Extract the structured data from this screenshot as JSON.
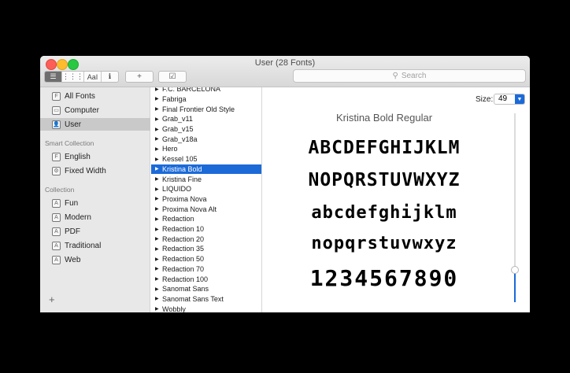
{
  "window": {
    "title": "User (28 Fonts)"
  },
  "toolbar": {
    "view_buttons": [
      {
        "name": "sidebar-view-button",
        "glyph": "☰"
      },
      {
        "name": "grid-view-button",
        "glyph": "⋮⋮⋮"
      },
      {
        "name": "sample-view-button",
        "glyph": "AaI"
      },
      {
        "name": "info-view-button",
        "glyph": "ℹ"
      }
    ],
    "add_glyph": "+",
    "validate_glyph": "☑",
    "search_placeholder": "Search",
    "search_icon_glyph": "⚲"
  },
  "sidebar": {
    "library": [
      {
        "label": "All Fonts",
        "icon": "F"
      },
      {
        "label": "Computer",
        "icon": "▭"
      },
      {
        "label": "User",
        "icon": "👤",
        "selected": true
      }
    ],
    "smart_heading": "Smart Collection",
    "smart": [
      {
        "label": "English",
        "icon": "F"
      },
      {
        "label": "Fixed Width",
        "icon": "⚙"
      }
    ],
    "collection_heading": "Collection",
    "collections": [
      {
        "label": "Fun",
        "icon": "A"
      },
      {
        "label": "Modern",
        "icon": "A"
      },
      {
        "label": "PDF",
        "icon": "A"
      },
      {
        "label": "Traditional",
        "icon": "A"
      },
      {
        "label": "Web",
        "icon": "A"
      }
    ],
    "add_glyph": "+"
  },
  "fonts": [
    "F.C. BARCELONA",
    "Fabriga",
    "Final Frontier Old Style",
    "Grab_v11",
    "Grab_v15",
    "Grab_v18a",
    "Hero",
    "Kessel 105",
    "Kristina Bold",
    "Kristina Fine",
    "LIQUIDO",
    "Proxima Nova",
    "Proxima Nova Alt",
    "Redaction",
    "Redaction 10",
    "Redaction 20",
    "Redaction 35",
    "Redaction 50",
    "Redaction 70",
    "Redaction 100",
    "Sanomat Sans",
    "Sanomat Sans Text",
    "Wobbly"
  ],
  "selected_font_index": 8,
  "preview": {
    "size_label": "Size:",
    "size_value": "49",
    "size_fraction": 0.17,
    "title": "Kristina Bold Regular",
    "lines": [
      "ABCDEFGHIJKLM",
      "NOPQRSTUVWXYZ",
      "abcdefghijklm",
      "nopqrstuvwxyz",
      "1234567890"
    ]
  },
  "colors": {
    "accent": "#1b6ad8"
  }
}
